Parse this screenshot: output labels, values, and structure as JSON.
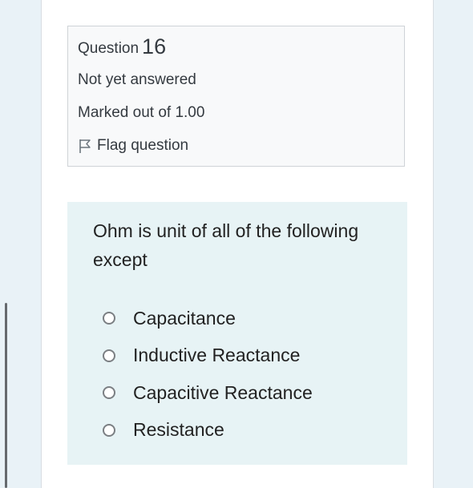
{
  "question_info": {
    "heading_prefix": "Question",
    "number": "16",
    "state": "Not yet answered",
    "grade": "Marked out of 1.00",
    "flag_label": "Flag question",
    "flag_icon": "flag-icon"
  },
  "question": {
    "text": "Ohm is unit of all of the following except",
    "answers": [
      {
        "label": "Capacitance",
        "selected": false
      },
      {
        "label": "Inductive Reactance",
        "selected": false
      },
      {
        "label": "Capacitive Reactance",
        "selected": false
      },
      {
        "label": "Resistance",
        "selected": false
      }
    ]
  },
  "colors": {
    "page_background": "#e9f2f7",
    "info_box_background": "#f8f9fa",
    "question_box_background": "#e7f3f5"
  }
}
